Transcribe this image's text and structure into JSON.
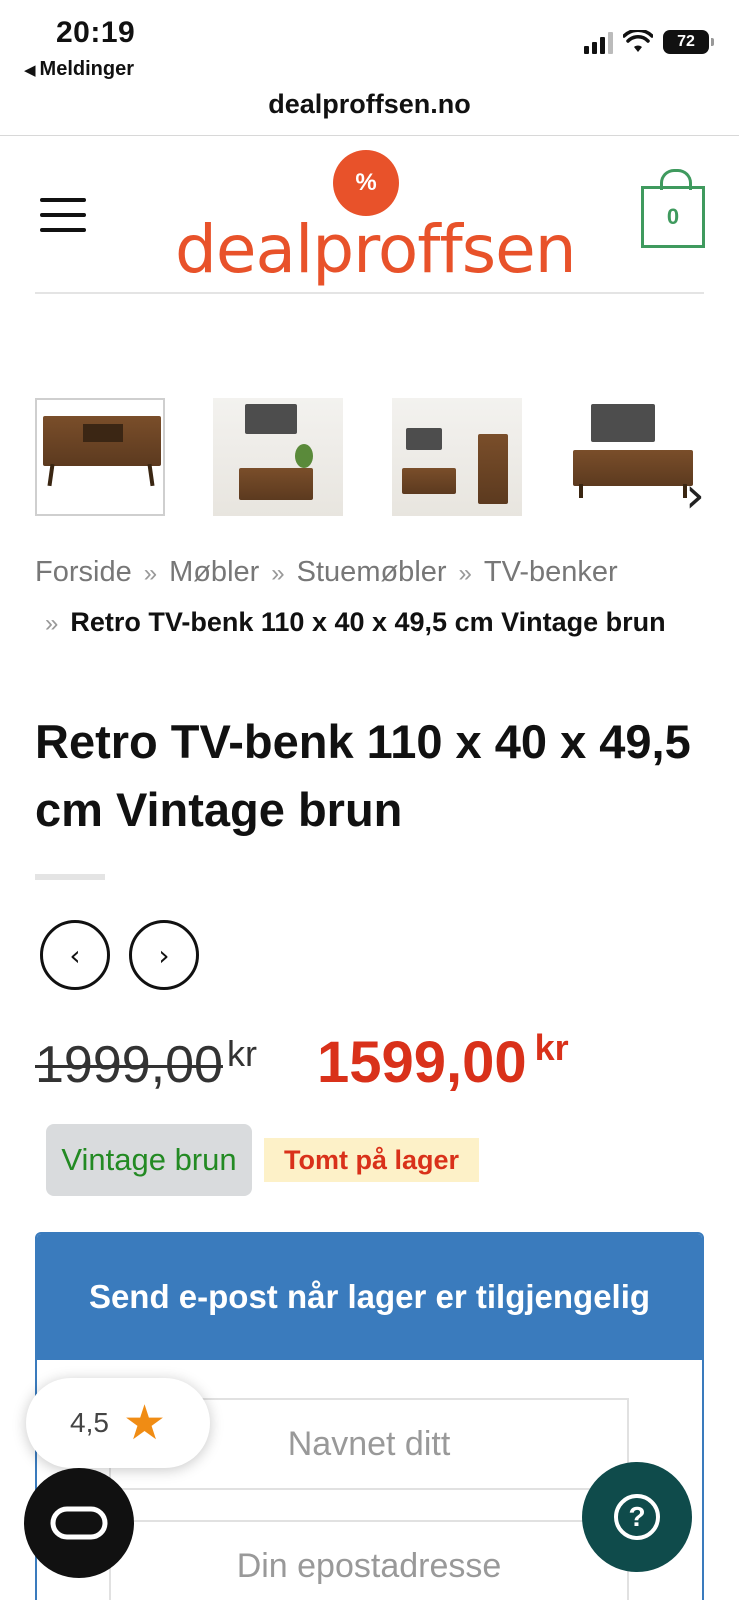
{
  "status_bar": {
    "time": "20:19",
    "back_app": "Meldinger",
    "battery": "72"
  },
  "browser": {
    "url": "dealproffsen.no"
  },
  "header": {
    "logo_text": "dealproffsen",
    "logo_badge": "%",
    "cart_count": "0",
    "brand_color": "#e8522a",
    "cart_color": "#3f9a5e"
  },
  "gallery": {
    "thumbnails": [
      {
        "name": "thumb-1"
      },
      {
        "name": "thumb-2"
      },
      {
        "name": "thumb-3"
      },
      {
        "name": "thumb-4"
      }
    ],
    "next_icon": "chevron-right-icon"
  },
  "breadcrumb": {
    "items": [
      "Forside",
      "Møbler",
      "Stuemøbler",
      "TV-benker"
    ],
    "separator": "»",
    "current": "Retro TV-benk 110 x 40 x 49,5 cm Vintage brun"
  },
  "product": {
    "title": "Retro TV-benk 110 x 40 x 49,5 cm Vintage brun",
    "old_price": "1999,00",
    "new_price": "1599,00",
    "currency": "kr",
    "variant": "Vintage brun",
    "stock_status": "Tomt på lager",
    "price_color": "#d9311a"
  },
  "notify": {
    "heading": "Send e-post når lager er tilgjengelig",
    "name_placeholder": "Navnet ditt",
    "email_placeholder": "Din epostadresse",
    "accent": "#3a7bbd"
  },
  "widgets": {
    "rating": "4,5",
    "help_symbol": "?"
  }
}
